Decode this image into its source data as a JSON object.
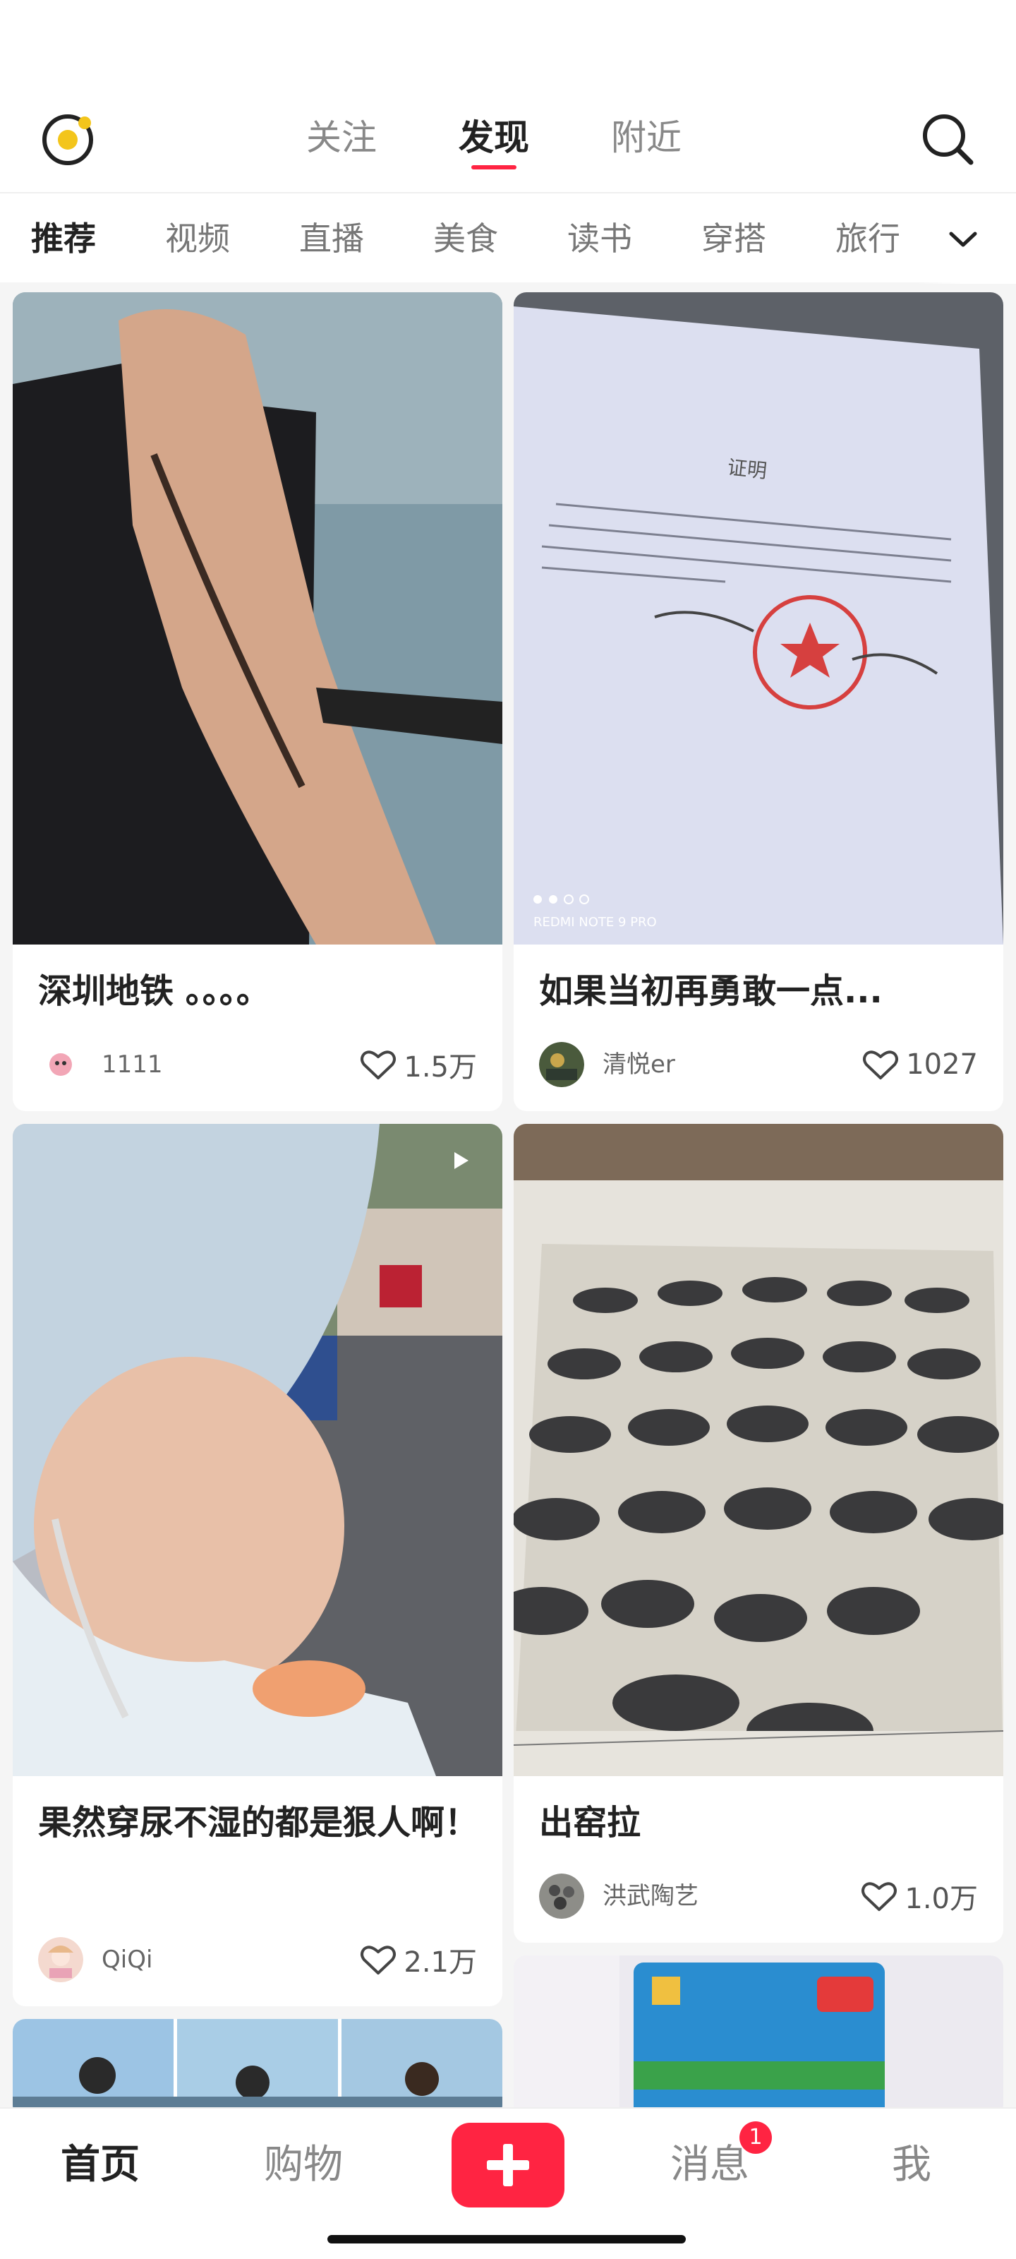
{
  "header": {
    "tabs": [
      {
        "label": "关注"
      },
      {
        "label": "发现"
      },
      {
        "label": "附近"
      }
    ],
    "active_tab": "发现",
    "accent_color": "#ff2442"
  },
  "categories": {
    "items": [
      {
        "label": "推荐"
      },
      {
        "label": "视频"
      },
      {
        "label": "直播"
      },
      {
        "label": "美食"
      },
      {
        "label": "读书"
      },
      {
        "label": "穿搭"
      },
      {
        "label": "旅行"
      }
    ],
    "active": "推荐",
    "more_icon": "chevron-down-icon"
  },
  "feed": [
    {
      "title": "深圳地铁 。。。。",
      "author": "1111",
      "likes": "1.5万"
    },
    {
      "title": "如果当初再勇敢一点...",
      "author": "清悦er",
      "likes": "1027",
      "image_caption": "REDMI NOTE 9 PRO"
    },
    {
      "title": "果然穿尿不湿的都是狠人啊！",
      "author": "QiQi",
      "likes": "2.1万"
    },
    {
      "title": "出窑拉",
      "author": "洪武陶艺",
      "likes": "1.0万"
    }
  ],
  "bottom_nav": {
    "items": [
      {
        "label": "首页"
      },
      {
        "label": "购物"
      },
      {
        "label": "消息"
      },
      {
        "label": "我"
      }
    ],
    "messages_badge": "1",
    "active": "首页"
  }
}
